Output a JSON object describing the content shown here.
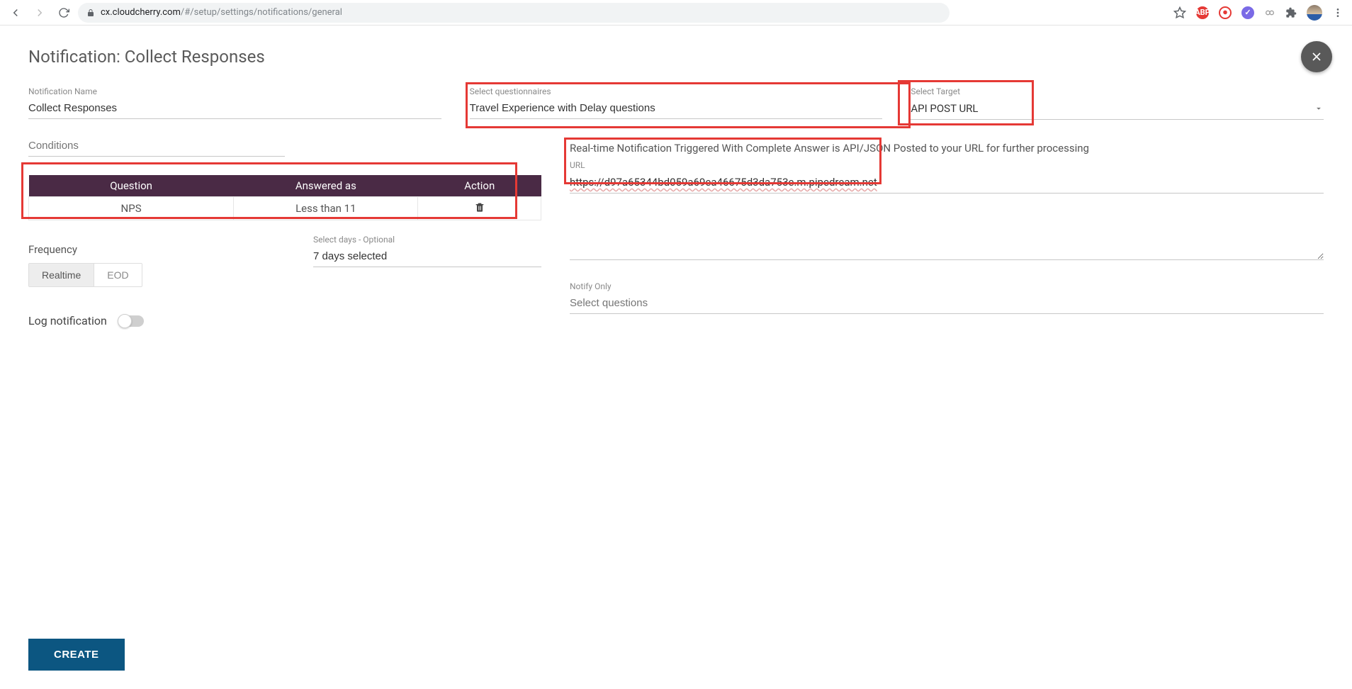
{
  "browser": {
    "url_host": "cx.cloudcherry.com",
    "url_path": "/#/setup/settings/notifications/general"
  },
  "header": {
    "title": "Notification: Collect Responses"
  },
  "fields": {
    "name_label": "Notification Name",
    "name_value": "Collect Responses",
    "questionnaire_label": "Select questionnaires",
    "questionnaire_value": "Travel Experience with Delay questions",
    "target_label": "Select Target",
    "target_value": "API POST URL",
    "conditions_label": "Conditions",
    "days_label": "Select days - Optional",
    "days_value": "7 days selected",
    "url_label": "URL",
    "url_value": "https://d97a65344bd059a69ea46675d3da753e.m.pipedream.net",
    "notify_label": "Notify Only",
    "notify_placeholder": "Select questions"
  },
  "table": {
    "headers": {
      "question": "Question",
      "answered": "Answered as",
      "action": "Action"
    },
    "row": {
      "question": "NPS",
      "answered": "Less than  11"
    }
  },
  "frequency": {
    "label": "Frequency",
    "realtime": "Realtime",
    "eod": "EOD"
  },
  "log_label": "Log notification",
  "target_description": "Real-time Notification Triggered With Complete Answer is API/JSON Posted to your URL for further processing",
  "create": "CREATE"
}
